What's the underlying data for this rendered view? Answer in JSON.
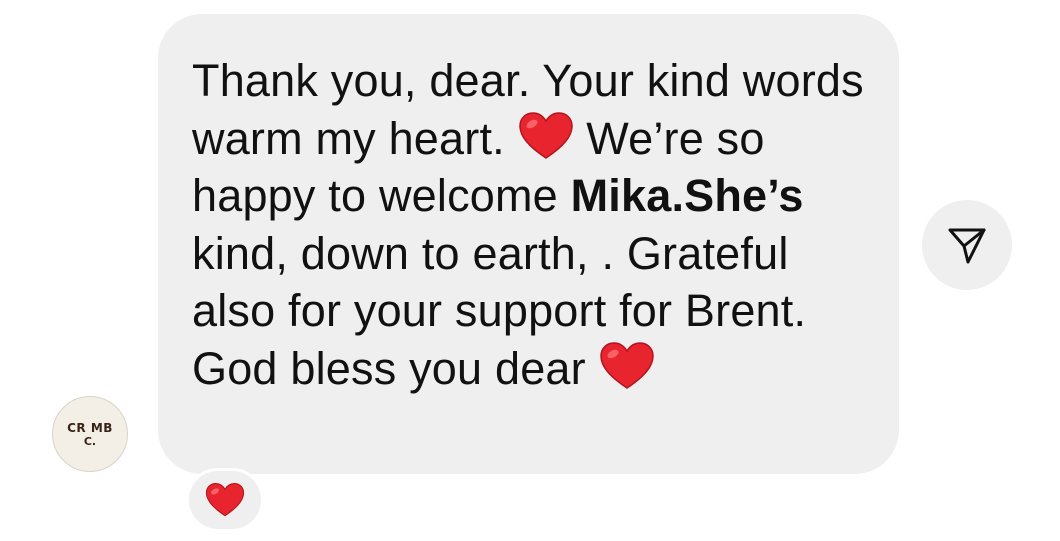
{
  "sender": {
    "avatar_line1": "CR MB",
    "avatar_line2": "C."
  },
  "message": {
    "part1": "Thank you, dear. Your kind words warm my heart. ",
    "emoji1": "red-heart",
    "part2": " We’re so happy to welcome ",
    "bold": "Mika.She’s",
    "part3": " kind, down to earth, . Grateful also for your support for Brent. God bless you dear ",
    "emoji2": "red-heart"
  },
  "reaction": {
    "emoji": "red-heart"
  },
  "share": {
    "icon": "paper-plane-icon"
  },
  "colors": {
    "bubble": "#efefef",
    "heart": "#e8252f",
    "text": "#111111"
  }
}
